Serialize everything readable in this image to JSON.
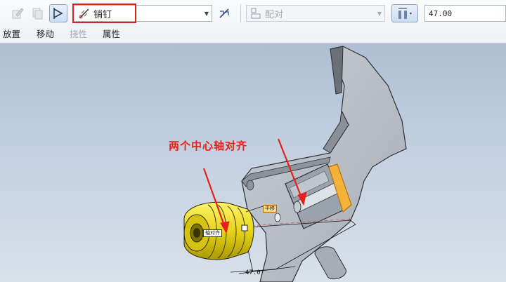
{
  "toolbar": {
    "constraint_type": "销钉",
    "mode_combo": "配对",
    "offset_value": "47.00"
  },
  "tabs": [
    {
      "label": "放置",
      "enabled": true
    },
    {
      "label": "移动",
      "enabled": true
    },
    {
      "label": "挠性",
      "enabled": false
    },
    {
      "label": "属性",
      "enabled": true
    }
  ],
  "viewport": {
    "annotation": "两个中心轴对齐",
    "tag_axis_left": "轴对齐",
    "tag_axis_right": "平移",
    "dimension": "47.0"
  },
  "colors": {
    "highlight": "#e02020",
    "annotation": "#e8201c",
    "part_yellow": "#f2e21c",
    "part_gray": "#b9bfc6",
    "selection_orange": "#f0a020"
  }
}
